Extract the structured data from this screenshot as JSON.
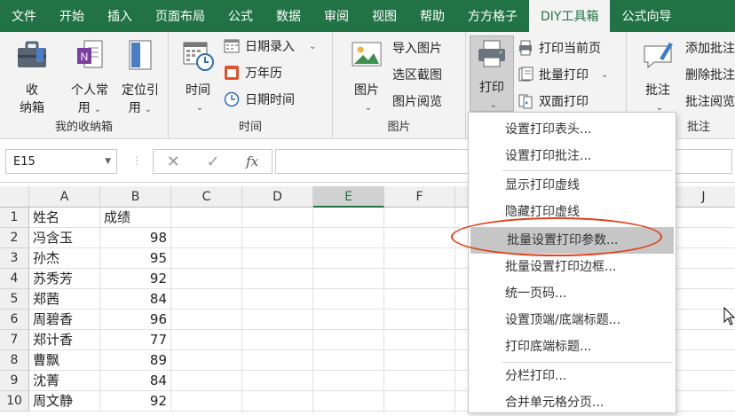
{
  "menubar": {
    "tabs": [
      "文件",
      "开始",
      "插入",
      "页面布局",
      "公式",
      "数据",
      "审阅",
      "视图",
      "帮助",
      "方方格子",
      "DIY工具箱",
      "公式向导"
    ],
    "active_tab": "DIY工具箱"
  },
  "ribbon": {
    "storage_group": {
      "label": "我的收纳箱",
      "btn1": "收\n纳箱",
      "btn1_a": "收",
      "btn1_b": "纳箱",
      "btn2_a": "个人常",
      "btn2_b": "用",
      "btn3_a": "定位引",
      "btn3_b": "用"
    },
    "time_group": {
      "label": "时间",
      "time_btn": "时间",
      "date_entry": "日期录入",
      "calendar": "万年历",
      "datetime": "日期时间"
    },
    "image_group": {
      "label": "图片",
      "image_btn": "图片",
      "import_image": "导入图片",
      "region_capture": "选区截图",
      "image_view": "图片阅览"
    },
    "print_group": {
      "print_btn": "打印",
      "print_current": "打印当前页",
      "batch_print": "批量打印",
      "duplex_print": "双面打印"
    },
    "comment_group": {
      "label": "批注",
      "comment_btn": "批注",
      "add_comment": "添加批注",
      "delete_comment": "删除批注",
      "comment_view": "批注阅览"
    }
  },
  "formula_bar": {
    "name_box": "E15",
    "fx": "fx"
  },
  "sheet": {
    "columns": [
      "A",
      "B",
      "C",
      "D",
      "E",
      "F",
      "J"
    ],
    "rows": [
      {
        "n": "1",
        "a": "姓名",
        "b": "成绩"
      },
      {
        "n": "2",
        "a": "冯含玉",
        "b": "98"
      },
      {
        "n": "3",
        "a": "孙杰",
        "b": "95"
      },
      {
        "n": "4",
        "a": "苏秀芳",
        "b": "92"
      },
      {
        "n": "5",
        "a": "郑茜",
        "b": "84"
      },
      {
        "n": "6",
        "a": "周碧香",
        "b": "96"
      },
      {
        "n": "7",
        "a": "郑计香",
        "b": "77"
      },
      {
        "n": "8",
        "a": "曹飘",
        "b": "89"
      },
      {
        "n": "9",
        "a": "沈菁",
        "b": "84"
      },
      {
        "n": "10",
        "a": "周文静",
        "b": "92"
      }
    ]
  },
  "print_menu": {
    "items": [
      "设置打印表头...",
      "设置打印批注...",
      "显示打印虚线",
      "隐藏打印虚线",
      "批量设置打印参数...",
      "批量设置打印边框...",
      "统一页码...",
      "设置顶端/底端标题...",
      "打印底端标题...",
      "分栏打印...",
      "合并单元格分页..."
    ],
    "highlighted": "批量设置打印参数..."
  },
  "colors": {
    "accent": "#217346",
    "annotation": "#e2401c"
  }
}
